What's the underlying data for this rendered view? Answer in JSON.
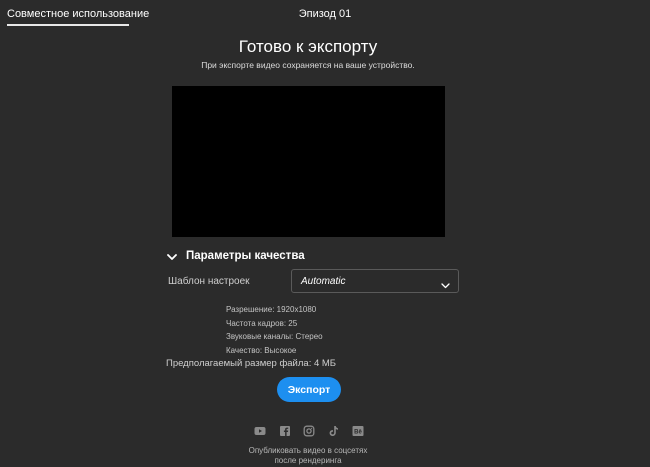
{
  "header": {
    "tab_share": "Совместное использование",
    "episode_title": "Эпизод 01"
  },
  "main": {
    "heading": "Готово к экспорту",
    "subheading": "При экспорте видео сохраняется на ваше устройство."
  },
  "quality": {
    "title": "Параметры качества",
    "preset_label": "Шаблон настроек",
    "preset_value": "Automatic",
    "resolution": "Разрешение: 1920x1080",
    "frame_rate": "Частота кадров: 25",
    "audio_channels": "Звуковые каналы: Стерео",
    "quality": "Качество: Высокое",
    "size_estimate": "Предполагаемый размер файла: 4 МБ"
  },
  "export": {
    "button_label": "Экспорт"
  },
  "social": {
    "icons": [
      "youtube-icon",
      "facebook-icon",
      "instagram-icon",
      "tiktok-icon",
      "behance-icon"
    ],
    "note_line1": "Опубликовать видео в соцсетях",
    "note_line2": "после рендеринга"
  },
  "colors": {
    "background": "#2b2b2b",
    "preview": "#000000",
    "accent": "#1d8ff0"
  }
}
